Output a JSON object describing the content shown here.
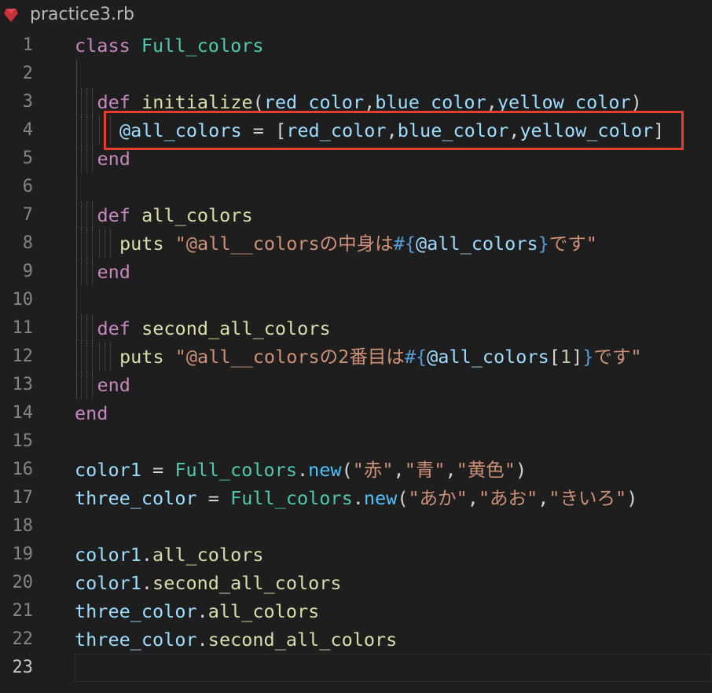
{
  "tab": {
    "filename": "practice3.rb",
    "icon": "ruby-icon"
  },
  "colors": {
    "highlight": "#e53e2f"
  },
  "editor": {
    "current_line": 23,
    "lines": [
      {
        "n": "1",
        "indent": 0,
        "tokens": [
          [
            "kw",
            "class"
          ],
          [
            "plain",
            " "
          ],
          [
            "cls",
            "Full_colors"
          ]
        ]
      },
      {
        "n": "2",
        "indent": 0,
        "tokens": []
      },
      {
        "n": "3",
        "indent": 1,
        "tokens": [
          [
            "kw",
            "def"
          ],
          [
            "plain",
            " "
          ],
          [
            "fn",
            "initialize"
          ],
          [
            "punc",
            "("
          ],
          [
            "var",
            "red_color"
          ],
          [
            "punc",
            ","
          ],
          [
            "var",
            "blue_color"
          ],
          [
            "punc",
            ","
          ],
          [
            "var",
            "yellow_color"
          ],
          [
            "punc",
            ")"
          ]
        ]
      },
      {
        "n": "4",
        "indent": 2,
        "tokens": [
          [
            "ivar",
            "@all_colors"
          ],
          [
            "plain",
            " = "
          ],
          [
            "punc",
            "["
          ],
          [
            "var",
            "red_color"
          ],
          [
            "punc",
            ","
          ],
          [
            "var",
            "blue_color"
          ],
          [
            "punc",
            ","
          ],
          [
            "var",
            "yellow_color"
          ],
          [
            "punc",
            "]"
          ]
        ]
      },
      {
        "n": "5",
        "indent": 1,
        "tokens": [
          [
            "kw",
            "end"
          ]
        ]
      },
      {
        "n": "6",
        "indent": 0,
        "tokens": []
      },
      {
        "n": "7",
        "indent": 1,
        "tokens": [
          [
            "kw",
            "def"
          ],
          [
            "plain",
            " "
          ],
          [
            "fn",
            "all_colors"
          ]
        ]
      },
      {
        "n": "8",
        "indent": 2,
        "tokens": [
          [
            "fn",
            "puts"
          ],
          [
            "plain",
            " "
          ],
          [
            "str",
            "\"@all__colorsの中身は"
          ],
          [
            "interp",
            "#{"
          ],
          [
            "ivar",
            "@all_colors"
          ],
          [
            "interp",
            "}"
          ],
          [
            "str",
            "です\""
          ]
        ]
      },
      {
        "n": "9",
        "indent": 1,
        "tokens": [
          [
            "kw",
            "end"
          ]
        ]
      },
      {
        "n": "10",
        "indent": 0,
        "tokens": []
      },
      {
        "n": "11",
        "indent": 1,
        "tokens": [
          [
            "kw",
            "def"
          ],
          [
            "plain",
            " "
          ],
          [
            "fn",
            "second_all_colors"
          ]
        ]
      },
      {
        "n": "12",
        "indent": 2,
        "tokens": [
          [
            "fn",
            "puts"
          ],
          [
            "plain",
            " "
          ],
          [
            "str",
            "\"@all__colorsの2番目は"
          ],
          [
            "interp",
            "#{"
          ],
          [
            "ivar",
            "@all_colors"
          ],
          [
            "punc",
            "["
          ],
          [
            "num",
            "1"
          ],
          [
            "punc",
            "]"
          ],
          [
            "interp",
            "}"
          ],
          [
            "str",
            "です\""
          ]
        ]
      },
      {
        "n": "13",
        "indent": 1,
        "tokens": [
          [
            "kw",
            "end"
          ]
        ]
      },
      {
        "n": "14",
        "indent": 0,
        "tokens": [
          [
            "kw",
            "end"
          ]
        ]
      },
      {
        "n": "15",
        "indent": 0,
        "tokens": []
      },
      {
        "n": "16",
        "indent": 0,
        "tokens": [
          [
            "var",
            "color1"
          ],
          [
            "plain",
            " = "
          ],
          [
            "cls",
            "Full_colors"
          ],
          [
            "punc",
            "."
          ],
          [
            "new",
            "new"
          ],
          [
            "punc",
            "("
          ],
          [
            "str",
            "\"赤\""
          ],
          [
            "punc",
            ","
          ],
          [
            "str",
            "\"青\""
          ],
          [
            "punc",
            ","
          ],
          [
            "str",
            "\"黄色\""
          ],
          [
            "punc",
            ")"
          ]
        ]
      },
      {
        "n": "17",
        "indent": 0,
        "tokens": [
          [
            "var",
            "three_color"
          ],
          [
            "plain",
            " = "
          ],
          [
            "cls",
            "Full_colors"
          ],
          [
            "punc",
            "."
          ],
          [
            "new",
            "new"
          ],
          [
            "punc",
            "("
          ],
          [
            "str",
            "\"あか\""
          ],
          [
            "punc",
            ","
          ],
          [
            "str",
            "\"あお\""
          ],
          [
            "punc",
            ","
          ],
          [
            "str",
            "\"きいろ\""
          ],
          [
            "punc",
            ")"
          ]
        ]
      },
      {
        "n": "18",
        "indent": 0,
        "tokens": []
      },
      {
        "n": "19",
        "indent": 0,
        "tokens": [
          [
            "var",
            "color1"
          ],
          [
            "punc",
            "."
          ],
          [
            "mth",
            "all_colors"
          ]
        ]
      },
      {
        "n": "20",
        "indent": 0,
        "tokens": [
          [
            "var",
            "color1"
          ],
          [
            "punc",
            "."
          ],
          [
            "mth",
            "second_all_colors"
          ]
        ]
      },
      {
        "n": "21",
        "indent": 0,
        "tokens": [
          [
            "var",
            "three_color"
          ],
          [
            "punc",
            "."
          ],
          [
            "mth",
            "all_colors"
          ]
        ]
      },
      {
        "n": "22",
        "indent": 0,
        "tokens": [
          [
            "var",
            "three_color"
          ],
          [
            "punc",
            "."
          ],
          [
            "mth",
            "second_all_colors"
          ]
        ]
      },
      {
        "n": "23",
        "indent": 0,
        "tokens": []
      }
    ]
  }
}
